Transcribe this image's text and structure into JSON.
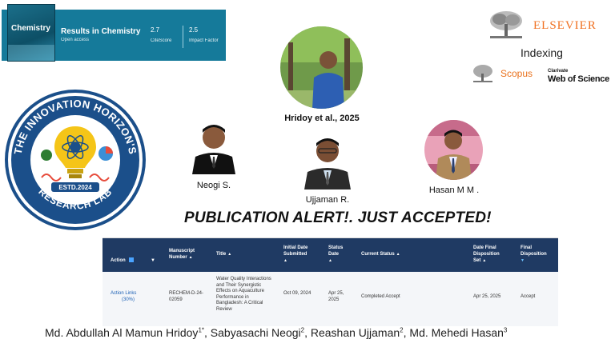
{
  "journal": {
    "cover_title": "Chemistry",
    "name": "Results in Chemistry",
    "access": "Open access",
    "citescore_value": "2.7",
    "citescore_label": "CiteScore",
    "impact_value": "2.5",
    "impact_label": "Impact Factor"
  },
  "publisher": {
    "name": "ELSEVIER",
    "indexing_label": "Indexing",
    "index_1": "Scopus",
    "index_2_small": "Clarivate",
    "index_2": "Web of Science"
  },
  "lab_logo": {
    "text_top": "THE INNOVATION HORIZON'S",
    "text_bottom": "RESEARCH LAB",
    "established": "ESTD.2024"
  },
  "people": {
    "hridoy_caption": "Hridoy et al., 2025",
    "neogi_caption": "Neogi S.",
    "ujjaman_caption": "Ujjaman R.",
    "hasan_caption": "Hasan M M ."
  },
  "headline": "PUBLICATION ALERT!. JUST ACCEPTED!",
  "table": {
    "headers": {
      "action": "Action",
      "manuscript": "Manuscript Number",
      "title": "Title",
      "initial_date": "Initial Date Submitted",
      "status_date": "Status Date",
      "current_status": "Current Status",
      "final_date": "Date Final Disposition Set",
      "final_disp": "Final Disposition"
    },
    "row": {
      "action": "Action Links",
      "action_pct": "(30%)",
      "manuscript": "RECHEM-D-24-02059",
      "title": "Water Quality Interactions and Their Synergistic Effects on Aquaculture Performance in Bangladesh: A Critical Review",
      "initial_date": "Oct 09, 2024",
      "status_date": "Apr 25, 2025",
      "current_status": "Completed Accept",
      "final_date": "Apr 25, 2025",
      "final_disp": "Accept"
    }
  },
  "authors": {
    "a1": "Md. Abdullah Al Mamun Hridoy",
    "a1_sup": "1*",
    "a2": "Sabyasachi Neogi",
    "a2_sup": "2",
    "a3": "Reashan Ujjaman",
    "a3_sup": "2",
    "a4": "Md. Mehedi Hasan",
    "a4_sup": "3"
  },
  "colors": {
    "journal_banner": "#157a9a",
    "table_header": "#1f3a63",
    "elsevier_orange": "#f07020"
  }
}
